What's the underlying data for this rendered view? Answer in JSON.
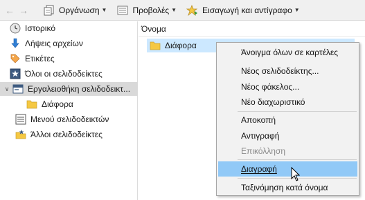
{
  "toolbar": {
    "back_icon": "arrow-left-icon",
    "forward_icon": "arrow-right-icon",
    "organize_label": "Οργάνωση",
    "views_label": "Προβολές",
    "import_label": "Εισαγωγή και αντίγραφο"
  },
  "sidebar": {
    "items": [
      {
        "label": "Ιστορικό",
        "icon": "clock-icon"
      },
      {
        "label": "Λήψεις αρχείων",
        "icon": "download-arrow-icon"
      },
      {
        "label": "Ετικέτες",
        "icon": "tag-icon"
      },
      {
        "label": "Όλοι οι σελιδοδείκτες",
        "icon": "star-icon"
      },
      {
        "label": "Εργαλειοθήκη σελιδοδεικτ...",
        "icon": "toolbar-icon"
      },
      {
        "label": "Διάφορα",
        "icon": "folder-icon"
      },
      {
        "label": "Μενού σελιδοδεικτών",
        "icon": "bookmarks-menu-icon"
      },
      {
        "label": "Άλλοι σελιδοδείκτες",
        "icon": "other-bookmarks-icon"
      }
    ]
  },
  "content": {
    "column_header": "Όνομα",
    "rows": [
      {
        "name": "Διάφορα",
        "icon": "folder-icon"
      }
    ]
  },
  "context_menu": {
    "items": [
      {
        "label": "Άνοιγμα όλων σε καρτέλες",
        "enabled": true
      },
      {
        "label": "Νέος σελιδοδείκτης...",
        "enabled": true
      },
      {
        "label": "Νέος φάκελος...",
        "enabled": true
      },
      {
        "label": "Νέο διαχωριστικό",
        "enabled": true
      },
      {
        "label": "Αποκοπή",
        "enabled": true
      },
      {
        "label": "Αντιγραφή",
        "enabled": true
      },
      {
        "label": "Επικόλληση",
        "enabled": false
      },
      {
        "label": "Διαγραφή",
        "enabled": true,
        "highlighted": true
      },
      {
        "label": "Ταξινόμηση κατά όνομα",
        "enabled": true
      }
    ]
  },
  "colors": {
    "selection": "#cce8ff",
    "menu_highlight": "#91c9f7",
    "folder": "#f5c842"
  }
}
